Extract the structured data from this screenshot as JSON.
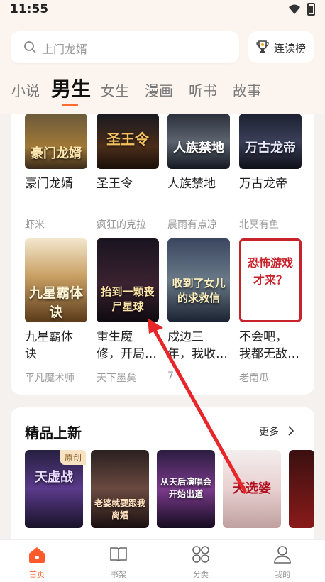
{
  "status": {
    "time": "11:55"
  },
  "search": {
    "placeholder": "上门龙婿"
  },
  "rank_button": {
    "label": "连读榜"
  },
  "tabs": [
    {
      "label": "小说"
    },
    {
      "label": "男生"
    },
    {
      "label": "女生"
    },
    {
      "label": "漫画"
    },
    {
      "label": "听书"
    },
    {
      "label": "故事"
    }
  ],
  "grid": {
    "row1": [
      {
        "title": "豪门龙婿",
        "author": "虾米",
        "cover_text": "豪门龙婿"
      },
      {
        "title": "圣王令",
        "author": "疯狂的克拉",
        "cover_text": "圣王令"
      },
      {
        "title": "人族禁地",
        "author": "晨雨有点凉",
        "cover_text": "人族禁地"
      },
      {
        "title": "万古龙帝",
        "author": "北冥有鱼",
        "cover_text": "万古龙帝"
      }
    ],
    "row2": [
      {
        "title_line1": "九星霸体",
        "title_line2": "诀",
        "author": "平凡魔术师",
        "cover_text": "九星霸体诀"
      },
      {
        "title_line1": "重生魔",
        "title_line2": "修，开局…",
        "author": "天下墨矣",
        "cover_text": "抬到一颗丧尸星球"
      },
      {
        "title_line1": "戍边三",
        "title_line2": "年，我收…",
        "author": "7",
        "cover_text": "收到了女儿的求救信"
      },
      {
        "title_line1": "不会吧，",
        "title_line2": "我都无敌…",
        "author": "老南瓜",
        "cover_text": "恐怖游戏才来？"
      }
    ]
  },
  "new_section": {
    "title": "精品上新",
    "more": "更多",
    "badge": "原创",
    "covers": [
      {
        "text": "天虚战"
      },
      {
        "text": "老婆就要跟我离婚"
      },
      {
        "text": "从天后演唱会开始出道"
      },
      {
        "text": "天选婆"
      }
    ]
  },
  "nav": [
    {
      "label": "首页"
    },
    {
      "label": "书架"
    },
    {
      "label": "分类"
    },
    {
      "label": "我的"
    }
  ],
  "colors": {
    "accent": "#ff5a2b",
    "bg": "#f5f1ee",
    "annotation": "#e8262a"
  }
}
